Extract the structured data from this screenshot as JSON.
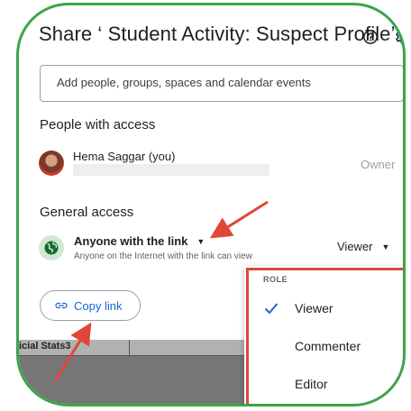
{
  "dialog": {
    "title": "Share ‘ Student Activity: Suspect Profile’",
    "add_people_placeholder": "Add people, groups, spaces and calendar events"
  },
  "people_section": {
    "heading": "People with access",
    "people": [
      {
        "name": "Hema Saggar (you)",
        "role": "Owner"
      }
    ]
  },
  "general_access": {
    "heading": "General access",
    "link_setting": "Anyone with the link",
    "description": "Anyone on the Internet with the link can view",
    "role": "Viewer"
  },
  "copy_link_label": "Copy link",
  "background": {
    "partial_text": "icial Stats3"
  },
  "role_menu": {
    "header": "ROLE",
    "options": [
      "Viewer",
      "Commenter",
      "Editor"
    ],
    "selected": "Viewer"
  },
  "colors": {
    "accent": "#1a66d2",
    "annotation_red": "#e0463a",
    "frame_green": "#3aa64a"
  },
  "icons": [
    "help-icon",
    "gear-icon",
    "globe-icon",
    "link-icon",
    "check-icon",
    "dropdown-caret-icon"
  ]
}
